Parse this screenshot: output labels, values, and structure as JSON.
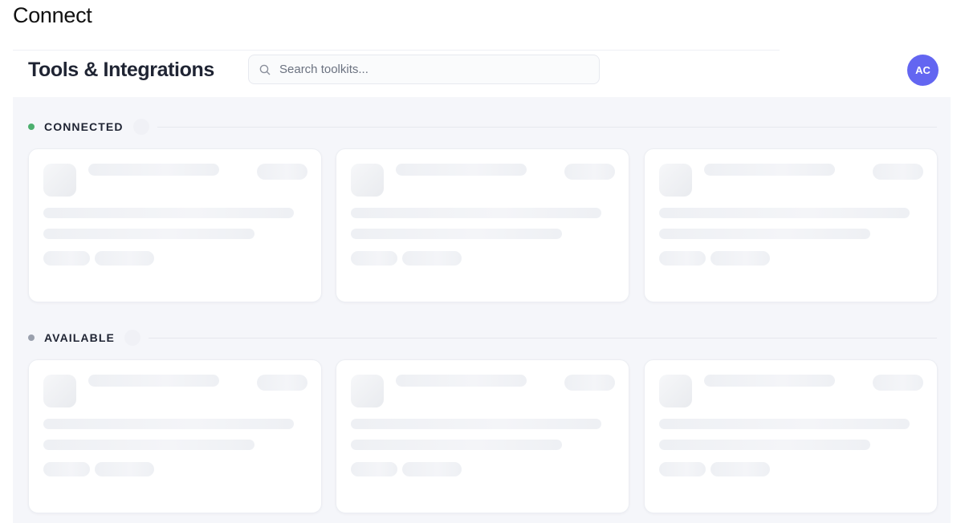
{
  "page": {
    "heading": "Connect"
  },
  "header": {
    "title": "Tools & Integrations",
    "search": {
      "placeholder": "Search toolkits...",
      "value": "",
      "icon": "search-icon"
    },
    "avatar": {
      "initials": "AC",
      "color": "#6366f1"
    }
  },
  "sections": [
    {
      "title": "CONNECTED",
      "dot_color": "#4caf6e",
      "cards_loading": 3
    },
    {
      "title": "AVAILABLE",
      "dot_color": "#9aa0ad",
      "cards_loading": 3
    }
  ],
  "colors": {
    "content_background": "#f5f6fa",
    "skeleton": "#eef0f4",
    "text_primary": "#1f2433"
  }
}
